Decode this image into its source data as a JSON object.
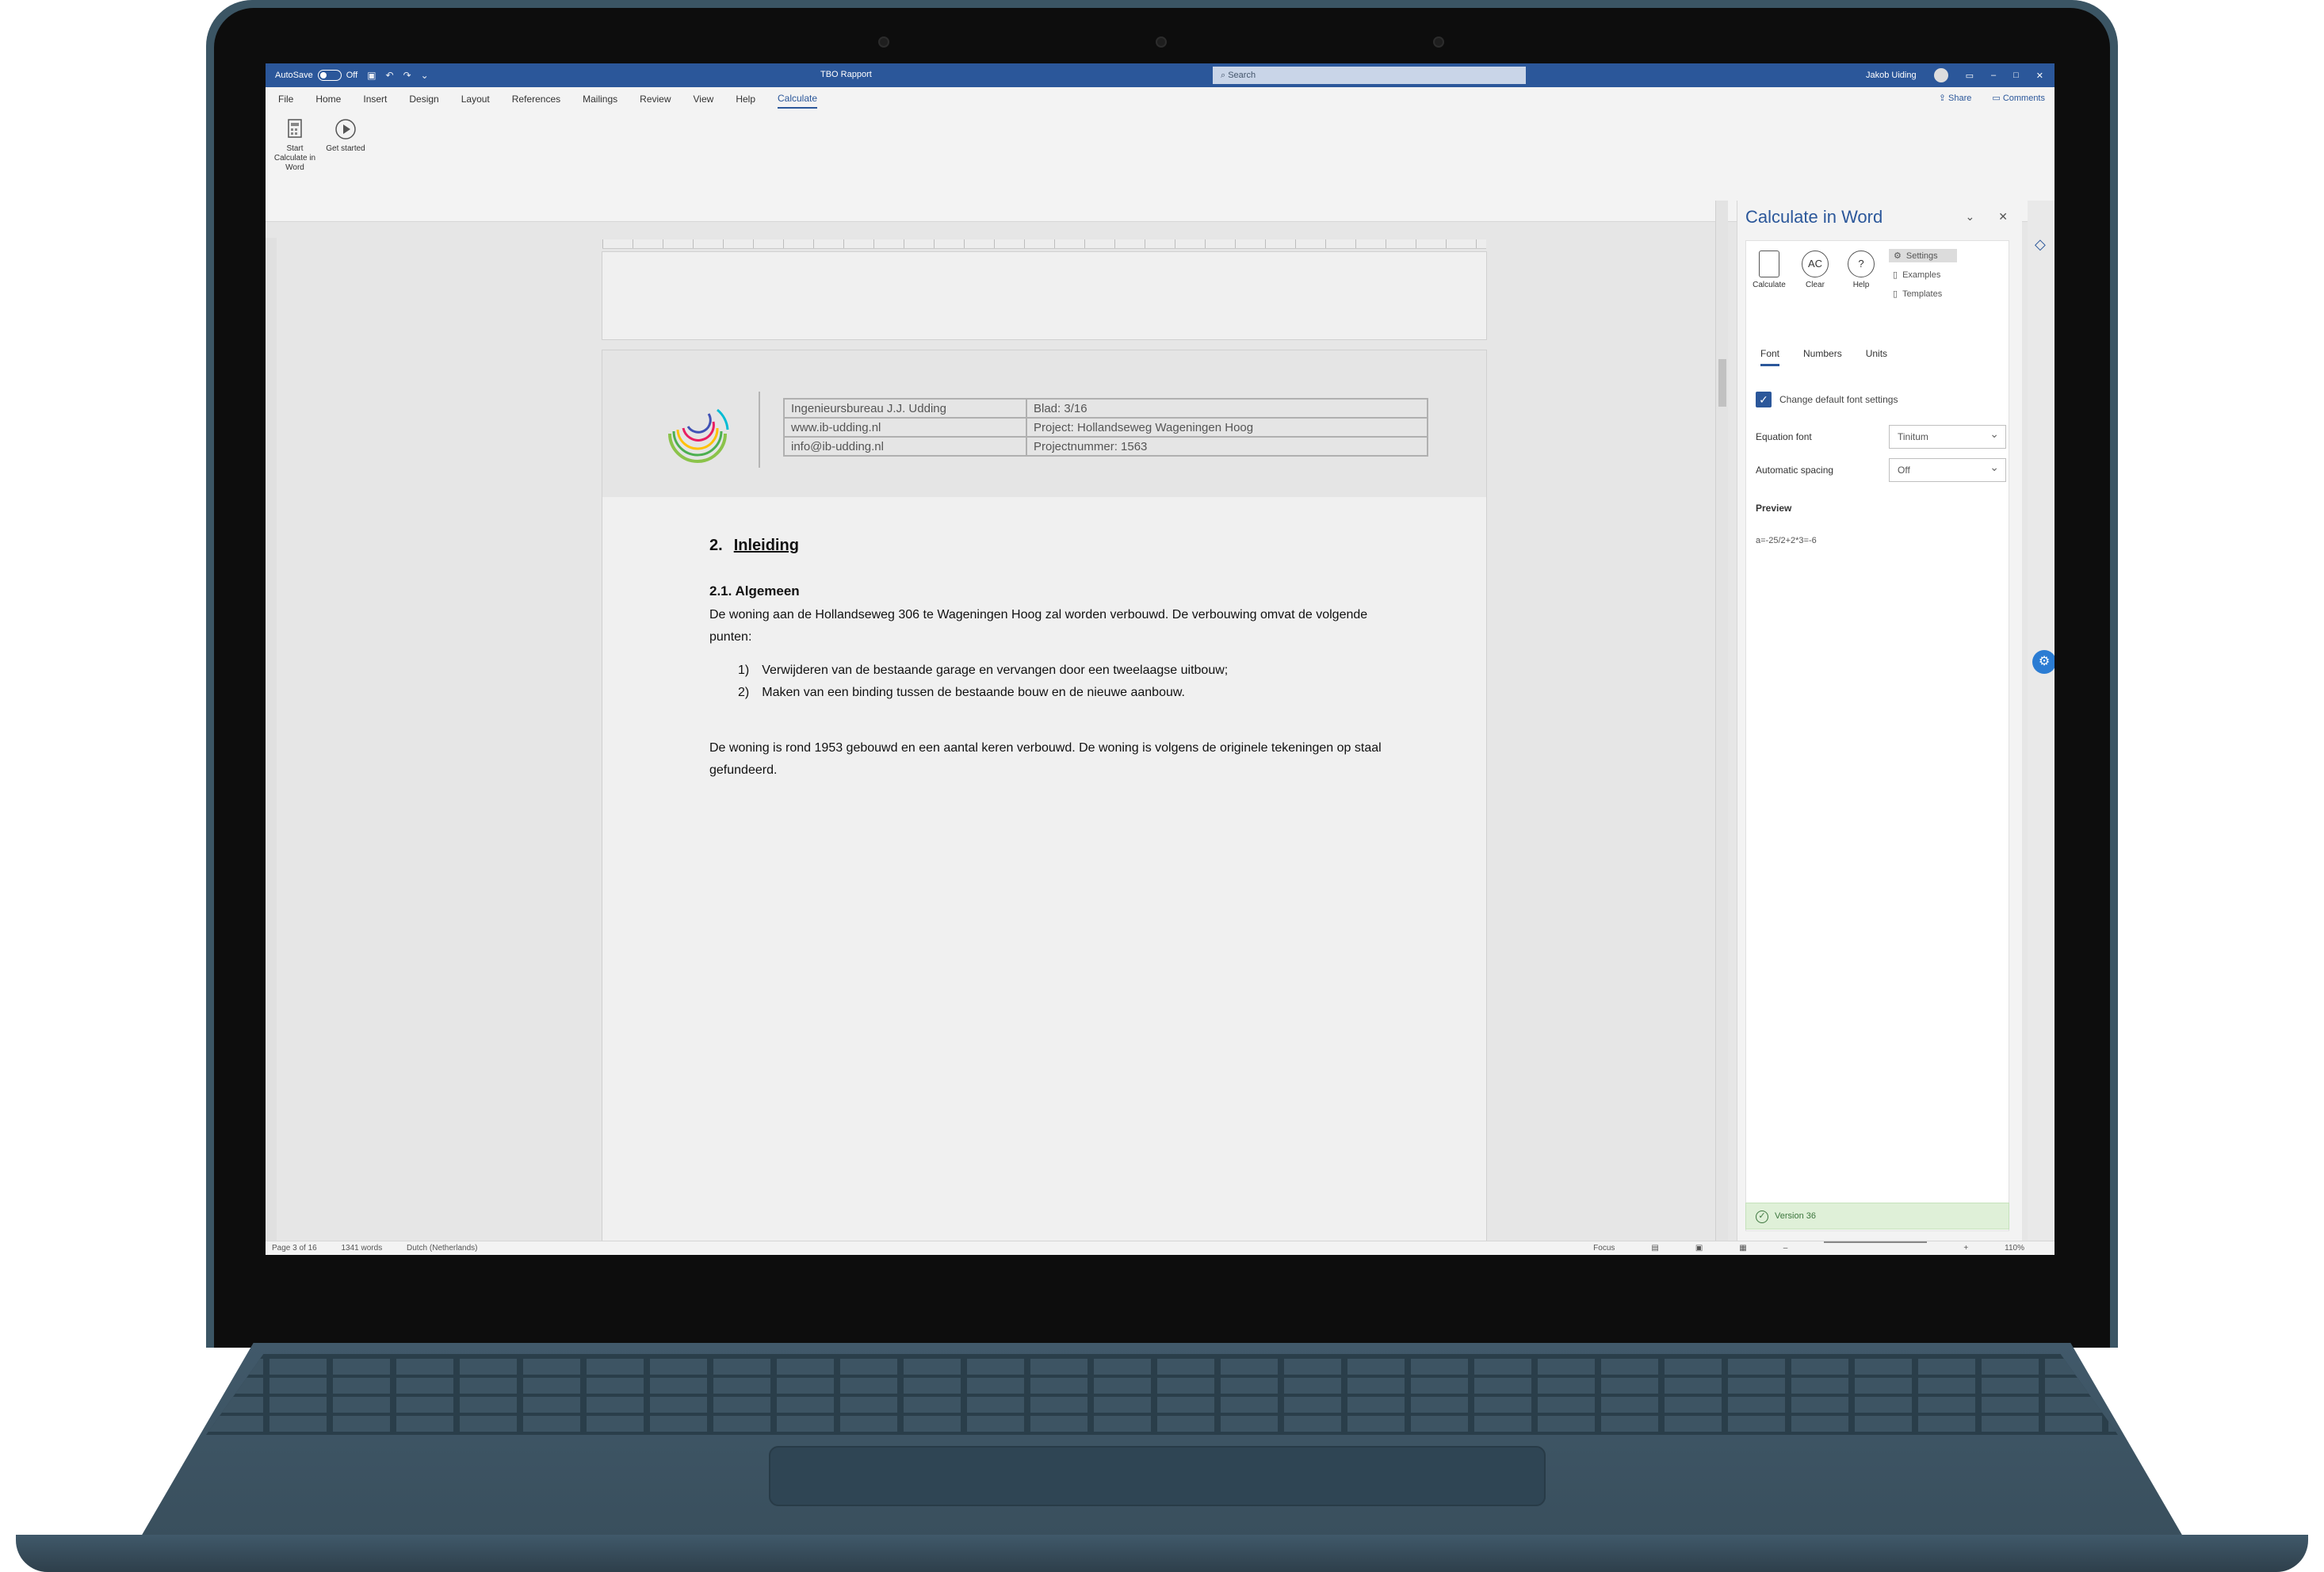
{
  "titlebar": {
    "autosave_label": "AutoSave",
    "autosave_state": "Off",
    "doc_title": "TBO Rapport",
    "search_placeholder": "Search",
    "user_name": "Jakob Uiding"
  },
  "menu": {
    "tabs": [
      "File",
      "Home",
      "Insert",
      "Design",
      "Layout",
      "References",
      "Mailings",
      "Review",
      "View",
      "Help",
      "Calculate"
    ],
    "active_tab": "Calculate",
    "share_label": "Share",
    "comments_label": "Comments"
  },
  "ribbon": {
    "start_label": "Start Calculate in Word",
    "get_started_label": "Get started"
  },
  "document": {
    "header": {
      "rows": [
        [
          "Ingenieursbureau J.J. Udding",
          "Blad: 3/16"
        ],
        [
          "www.ib-udding.nl",
          "Project: Hollandseweg Wageningen Hoog"
        ],
        [
          "info@ib-udding.nl",
          "Projectnummer: 1563"
        ]
      ]
    },
    "heading_num": "2.",
    "heading": "Inleiding",
    "subheading": "2.1. Algemeen",
    "para1": "De woning aan de Hollandseweg 306 te Wageningen Hoog zal worden verbouwd. De verbouwing omvat de volgende punten:",
    "list": [
      {
        "num": "1)",
        "text": "Verwijderen van de bestaande garage en vervangen door een tweelaagse uitbouw;"
      },
      {
        "num": "2)",
        "text": "Maken van een binding tussen de bestaande bouw en de nieuwe aanbouw."
      }
    ],
    "para2": "De woning is rond 1953 gebouwd en een aantal keren verbouwd. De woning is volgens de originele tekeningen op staal gefundeerd."
  },
  "taskpane": {
    "title": "Calculate in Word",
    "tools": [
      {
        "label": "Calculate",
        "icon": "calculate-icon",
        "glyph": ""
      },
      {
        "label": "Clear",
        "icon": "clear-icon",
        "glyph": "AC"
      },
      {
        "label": "Help",
        "icon": "help-icon",
        "glyph": "?"
      }
    ],
    "links": [
      "Settings",
      "Examples",
      "Templates"
    ],
    "tabs": [
      "Font",
      "Numbers",
      "Units"
    ],
    "checkbox_label": "Change default font settings",
    "equation_font_label": "Equation font",
    "equation_font_value": "Tinitum",
    "auto_spacing_label": "Automatic spacing",
    "auto_spacing_value": "Off",
    "preview_label": "Preview",
    "preview_text": "a=-25/2+2*3=-6",
    "version": "Version 36"
  },
  "statusbar": {
    "page": "Page 3 of 16",
    "words": "1341 words",
    "language": "Dutch (Netherlands)",
    "focus": "Focus",
    "zoom": "110%"
  },
  "colors": {
    "accent": "#2b579a",
    "laptop_body": "#3b5564",
    "bezel": "#0d0d0d"
  }
}
